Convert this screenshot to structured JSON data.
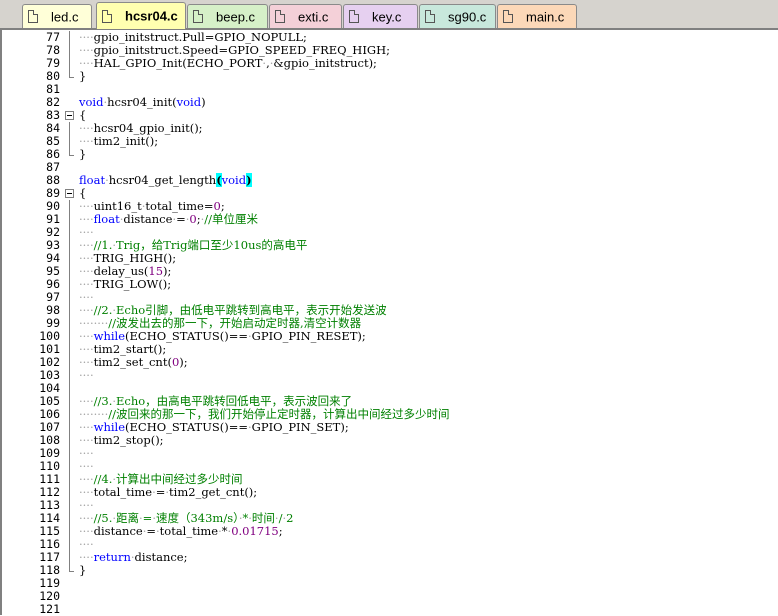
{
  "tabs": [
    {
      "label": "led.c",
      "color": "#ffffd8",
      "active": false
    },
    {
      "label": "hcsr04.c",
      "color": "#ffffb0",
      "active": true
    },
    {
      "label": "beep.c",
      "color": "#d6f0c8",
      "active": false
    },
    {
      "label": "exti.c",
      "color": "#f4d0d8",
      "active": false
    },
    {
      "label": "key.c",
      "color": "#e6d0f0",
      "active": false
    },
    {
      "label": "sg90.c",
      "color": "#c8e8dc",
      "active": false
    },
    {
      "label": "main.c",
      "color": "#fcd8b8",
      "active": false
    }
  ],
  "colors": {
    "keyword": "#0000ff",
    "comment": "#008000",
    "number": "#800080",
    "text": "#000000",
    "whitespace": "#a0a0a0",
    "brace_highlight": "#00ffff"
  },
  "code": {
    "lines": [
      {
        "n": "77",
        "fold": "vline",
        "segs": [
          [
            "ws",
            "····"
          ],
          [
            "t",
            "gpio_initstruct.Pull=GPIO_NOPULL;"
          ]
        ]
      },
      {
        "n": "78",
        "fold": "vline",
        "segs": [
          [
            "ws",
            "····"
          ],
          [
            "t",
            "gpio_initstruct.Speed=GPIO_SPEED_FREQ_HIGH;"
          ]
        ]
      },
      {
        "n": "79",
        "fold": "vline",
        "segs": [
          [
            "ws",
            "····"
          ],
          [
            "t",
            "HAL_GPIO_Init(ECHO_PORT"
          ],
          [
            "ws",
            "·"
          ],
          [
            "t",
            ","
          ],
          [
            "ws",
            "·"
          ],
          [
            "t",
            "&gpio_initstruct);"
          ]
        ]
      },
      {
        "n": "80",
        "fold": "end",
        "segs": [
          [
            "t",
            "}"
          ]
        ]
      },
      {
        "n": "81",
        "fold": "",
        "segs": []
      },
      {
        "n": "82",
        "fold": "",
        "segs": [
          [
            "k",
            "void"
          ],
          [
            "ws",
            "·"
          ],
          [
            "t",
            "hcsr04_init("
          ],
          [
            "k",
            "void"
          ],
          [
            "t",
            ")"
          ]
        ]
      },
      {
        "n": "83",
        "fold": "box",
        "segs": [
          [
            "t",
            "{"
          ]
        ]
      },
      {
        "n": "84",
        "fold": "vline",
        "segs": [
          [
            "ws",
            "····"
          ],
          [
            "t",
            "hcsr04_gpio_init();"
          ]
        ]
      },
      {
        "n": "85",
        "fold": "vline",
        "segs": [
          [
            "ws",
            "····"
          ],
          [
            "t",
            "tim2_init();"
          ]
        ]
      },
      {
        "n": "86",
        "fold": "end",
        "segs": [
          [
            "t",
            "}"
          ]
        ]
      },
      {
        "n": "87",
        "fold": "",
        "segs": []
      },
      {
        "n": "88",
        "fold": "",
        "segs": [
          [
            "k",
            "float"
          ],
          [
            "ws",
            "·"
          ],
          [
            "t",
            "hcsr04_get_length"
          ],
          [
            "hl",
            "("
          ],
          [
            "k",
            "void"
          ],
          [
            "hl",
            ")"
          ]
        ]
      },
      {
        "n": "89",
        "fold": "box",
        "segs": [
          [
            "t",
            "{"
          ]
        ]
      },
      {
        "n": "90",
        "fold": "vline",
        "segs": [
          [
            "ws",
            "····"
          ],
          [
            "t",
            "uint16_t"
          ],
          [
            "ws",
            "·"
          ],
          [
            "t",
            "total_time="
          ],
          [
            "num",
            "0"
          ],
          [
            "t",
            ";"
          ]
        ]
      },
      {
        "n": "91",
        "fold": "vline",
        "segs": [
          [
            "ws",
            "····"
          ],
          [
            "k",
            "float"
          ],
          [
            "ws",
            "·"
          ],
          [
            "t",
            "distance"
          ],
          [
            "ws",
            "·"
          ],
          [
            "t",
            "="
          ],
          [
            "ws",
            "·"
          ],
          [
            "num",
            "0"
          ],
          [
            "t",
            ";"
          ],
          [
            "ws",
            "·"
          ],
          [
            "c",
            "//单位厘米"
          ]
        ]
      },
      {
        "n": "92",
        "fold": "vline",
        "segs": [
          [
            "ws",
            "····"
          ]
        ]
      },
      {
        "n": "93",
        "fold": "vline",
        "segs": [
          [
            "ws",
            "····"
          ],
          [
            "c",
            "//1."
          ],
          [
            "ws",
            "·"
          ],
          [
            "c",
            "Trig，给Trig端口至少10us的高电平"
          ]
        ]
      },
      {
        "n": "94",
        "fold": "vline",
        "segs": [
          [
            "ws",
            "····"
          ],
          [
            "t",
            "TRIG_HIGH();"
          ]
        ]
      },
      {
        "n": "95",
        "fold": "vline",
        "segs": [
          [
            "ws",
            "····"
          ],
          [
            "t",
            "delay_us("
          ],
          [
            "num",
            "15"
          ],
          [
            "t",
            ");"
          ]
        ]
      },
      {
        "n": "96",
        "fold": "vline",
        "segs": [
          [
            "ws",
            "····"
          ],
          [
            "t",
            "TRIG_LOW();"
          ]
        ]
      },
      {
        "n": "97",
        "fold": "vline",
        "segs": [
          [
            "ws",
            "····"
          ]
        ]
      },
      {
        "n": "98",
        "fold": "vline",
        "segs": [
          [
            "ws",
            "····"
          ],
          [
            "c",
            "//2."
          ],
          [
            "ws",
            "·"
          ],
          [
            "c",
            "Echo引脚，由低电平跳转到高电平，表示开始发送波"
          ]
        ]
      },
      {
        "n": "99",
        "fold": "vline",
        "segs": [
          [
            "ws",
            "········"
          ],
          [
            "c",
            "//波发出去的那一下，开始启动定时器,清空计数器"
          ]
        ]
      },
      {
        "n": "100",
        "fold": "vline",
        "segs": [
          [
            "ws",
            "····"
          ],
          [
            "k",
            "while"
          ],
          [
            "t",
            "(ECHO_STATUS()=="
          ],
          [
            "ws",
            "·"
          ],
          [
            "t",
            "GPIO_PIN_RESET);"
          ]
        ]
      },
      {
        "n": "101",
        "fold": "vline",
        "segs": [
          [
            "ws",
            "····"
          ],
          [
            "t",
            "tim2_start();"
          ]
        ]
      },
      {
        "n": "102",
        "fold": "vline",
        "segs": [
          [
            "ws",
            "····"
          ],
          [
            "t",
            "tim2_set_cnt("
          ],
          [
            "num",
            "0"
          ],
          [
            "t",
            ");"
          ]
        ]
      },
      {
        "n": "103",
        "fold": "vline",
        "segs": [
          [
            "ws",
            "····"
          ]
        ]
      },
      {
        "n": "104",
        "fold": "vline",
        "segs": []
      },
      {
        "n": "105",
        "fold": "vline",
        "segs": [
          [
            "ws",
            "····"
          ],
          [
            "c",
            "//3."
          ],
          [
            "ws",
            "·"
          ],
          [
            "c",
            "Echo，由高电平跳转回低电平，表示波回来了"
          ]
        ]
      },
      {
        "n": "106",
        "fold": "vline",
        "segs": [
          [
            "ws",
            "········"
          ],
          [
            "c",
            "//波回来的那一下，我们开始停止定时器，计算出中间经过多少时间"
          ]
        ]
      },
      {
        "n": "107",
        "fold": "vline",
        "segs": [
          [
            "ws",
            "····"
          ],
          [
            "k",
            "while"
          ],
          [
            "t",
            "(ECHO_STATUS()=="
          ],
          [
            "ws",
            "·"
          ],
          [
            "t",
            "GPIO_PIN_SET);"
          ]
        ]
      },
      {
        "n": "108",
        "fold": "vline",
        "segs": [
          [
            "ws",
            "····"
          ],
          [
            "t",
            "tim2_stop();"
          ]
        ]
      },
      {
        "n": "109",
        "fold": "vline",
        "segs": [
          [
            "ws",
            "····"
          ]
        ]
      },
      {
        "n": "110",
        "fold": "vline",
        "segs": [
          [
            "ws",
            "····"
          ]
        ]
      },
      {
        "n": "111",
        "fold": "vline",
        "segs": [
          [
            "ws",
            "····"
          ],
          [
            "c",
            "//4."
          ],
          [
            "ws",
            "·"
          ],
          [
            "c",
            "计算出中间经过多少时间"
          ]
        ]
      },
      {
        "n": "112",
        "fold": "vline",
        "segs": [
          [
            "ws",
            "····"
          ],
          [
            "t",
            "total_time"
          ],
          [
            "ws",
            "·"
          ],
          [
            "t",
            "="
          ],
          [
            "ws",
            "·"
          ],
          [
            "t",
            "tim2_get_cnt();"
          ]
        ]
      },
      {
        "n": "113",
        "fold": "vline",
        "segs": [
          [
            "ws",
            "····"
          ]
        ]
      },
      {
        "n": "114",
        "fold": "vline",
        "segs": [
          [
            "ws",
            "····"
          ],
          [
            "c",
            "//5."
          ],
          [
            "ws",
            "·"
          ],
          [
            "c",
            "距离"
          ],
          [
            "ws",
            "·"
          ],
          [
            "c",
            "="
          ],
          [
            "ws",
            "·"
          ],
          [
            "c",
            "速度（343m/s）"
          ],
          [
            "ws",
            "·"
          ],
          [
            "c",
            "*"
          ],
          [
            "ws",
            "·"
          ],
          [
            "c",
            "时间"
          ],
          [
            "ws",
            "·"
          ],
          [
            "c",
            "/"
          ],
          [
            "ws",
            "·"
          ],
          [
            "c",
            "2"
          ]
        ]
      },
      {
        "n": "115",
        "fold": "vline",
        "segs": [
          [
            "ws",
            "····"
          ],
          [
            "t",
            "distance"
          ],
          [
            "ws",
            "·"
          ],
          [
            "t",
            "="
          ],
          [
            "ws",
            "·"
          ],
          [
            "t",
            "total_time"
          ],
          [
            "ws",
            "·"
          ],
          [
            "t",
            "*"
          ],
          [
            "ws",
            "·"
          ],
          [
            "num",
            "0.01715"
          ],
          [
            "t",
            ";"
          ]
        ]
      },
      {
        "n": "116",
        "fold": "vline",
        "segs": [
          [
            "ws",
            "····"
          ]
        ]
      },
      {
        "n": "117",
        "fold": "vline",
        "segs": [
          [
            "ws",
            "····"
          ],
          [
            "k",
            "return"
          ],
          [
            "ws",
            "·"
          ],
          [
            "t",
            "distance;"
          ]
        ]
      },
      {
        "n": "118",
        "fold": "end",
        "segs": [
          [
            "t",
            "}"
          ]
        ]
      },
      {
        "n": "119",
        "fold": "",
        "segs": []
      },
      {
        "n": "120",
        "fold": "",
        "segs": []
      },
      {
        "n": "121",
        "fold": "",
        "segs": []
      }
    ]
  }
}
